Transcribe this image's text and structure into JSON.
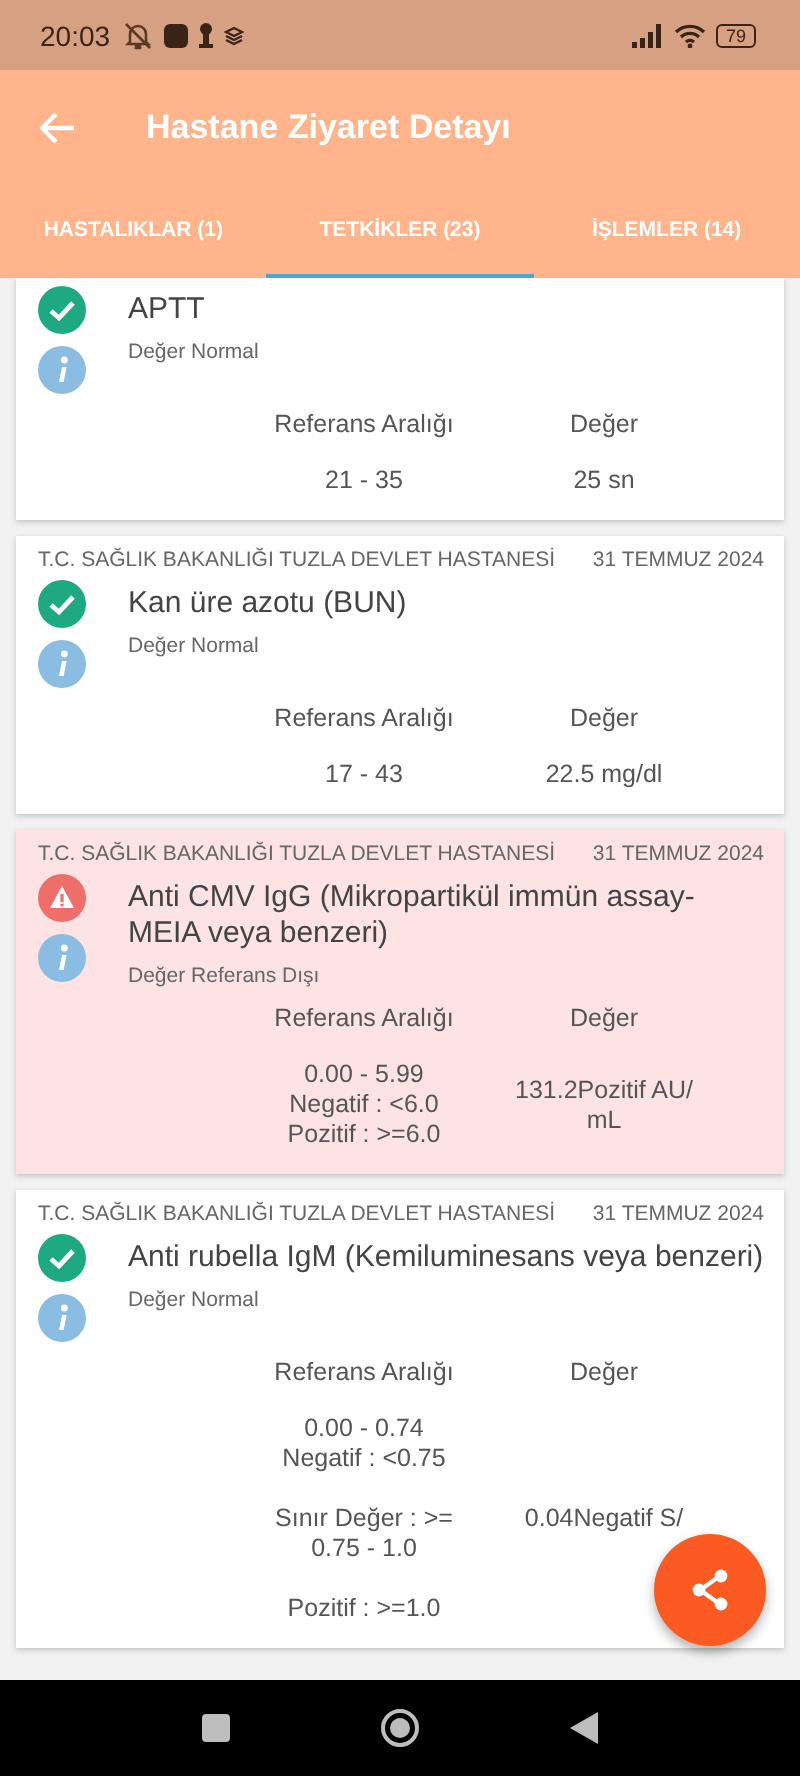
{
  "status_bar": {
    "time": "20:03",
    "battery": "79"
  },
  "app_bar": {
    "title": "Hastane Ziyaret Detayı"
  },
  "tabs": [
    {
      "label": "HASTALIKLAR (1)",
      "selected": false
    },
    {
      "label": "TETKİKLER (23)",
      "selected": true
    },
    {
      "label": "İŞLEMLER (14)",
      "selected": false
    }
  ],
  "results": [
    {
      "kind": "normal",
      "name": "APTT",
      "status": "Değer Normal",
      "range_label": "Referans Aralığı",
      "value_label": "Değer",
      "range": "21 - 35",
      "value": "25 sn"
    },
    {
      "kind": "normal",
      "hospital": "T.C. SAĞLIK BAKANLIĞI TUZLA DEVLET HASTANESİ",
      "date": "31 TEMMUZ 2024",
      "name": "Kan üre azotu (BUN)",
      "status": "Değer Normal",
      "range_label": "Referans Aralığı",
      "value_label": "Değer",
      "range": "17 - 43",
      "value": "22.5 mg/dl"
    },
    {
      "kind": "abnormal",
      "hospital": "T.C. SAĞLIK BAKANLIĞI TUZLA DEVLET HASTANESİ",
      "date": "31 TEMMUZ 2024",
      "name": "Anti CMV IgG (Mikropartikül immün assay-MEIA veya benzeri)",
      "status": "Değer Referans Dışı",
      "range_label": "Referans Aralığı",
      "value_label": "Değer",
      "range": "0.00 - 5.99\nNegatif : <6.0\nPozitif : >=6.0",
      "value": "131.2Pozitif AU/\nmL"
    },
    {
      "kind": "normal",
      "hospital": "T.C. SAĞLIK BAKANLIĞI TUZLA DEVLET HASTANESİ",
      "date": "31 TEMMUZ 2024",
      "name": "Anti rubella IgM (Kemiluminesans veya benzeri)",
      "status": "Değer Normal",
      "range_label": "Referans Aralığı",
      "value_label": "Değer",
      "range": "0.00 - 0.74\nNegatif   : <0.75\n\nSınır Değer : >=\n0.75 - 1.0\n\nPozitif   : >=1.0",
      "value": "0.04Negatif S/"
    }
  ]
}
